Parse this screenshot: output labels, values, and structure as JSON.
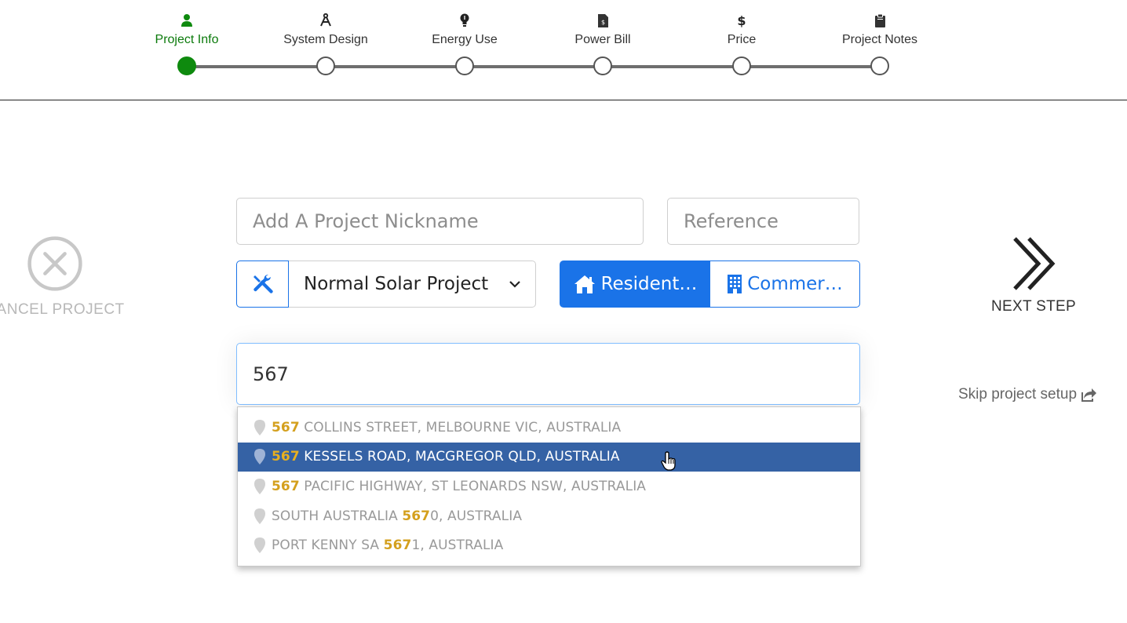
{
  "stepper": {
    "steps": [
      {
        "label": "Project Info",
        "icon": "person-icon",
        "active": true
      },
      {
        "label": "System Design",
        "icon": "compass-icon",
        "active": false
      },
      {
        "label": "Energy Use",
        "icon": "lightbulb-icon",
        "active": false
      },
      {
        "label": "Power Bill",
        "icon": "document-dollar-icon",
        "active": false
      },
      {
        "label": "Price",
        "icon": "dollar-icon",
        "active": false
      },
      {
        "label": "Project Notes",
        "icon": "clipboard-icon",
        "active": false
      }
    ],
    "active_color": "#0e8a0e"
  },
  "cancel": {
    "label": "CANCEL PROJECT",
    "icon": "close-circle-icon"
  },
  "next": {
    "label": "NEXT STEP",
    "icon": "double-chevron-right-icon"
  },
  "skip": {
    "label": "Skip project setup",
    "icon": "share-icon"
  },
  "form": {
    "nickname_placeholder": "Add A Project Nickname",
    "reference_placeholder": "Reference",
    "project_type": {
      "value": "Normal Solar Project",
      "icon": "wrench-screwdriver-icon"
    },
    "segment": {
      "residential": {
        "label": "Resident…",
        "icon": "house-icon",
        "selected": true
      },
      "commercial": {
        "label": "Commer…",
        "icon": "building-icon",
        "selected": false
      }
    },
    "address_value": "567"
  },
  "autocomplete": {
    "items": [
      {
        "match": "567",
        "rest": " COLLINS STREET, MELBOURNE VIC, AUSTRALIA",
        "pre": "",
        "selected": false
      },
      {
        "match": "567",
        "rest": " KESSELS ROAD, MACGREGOR QLD, AUSTRALIA",
        "pre": "",
        "selected": true
      },
      {
        "match": "567",
        "rest": " PACIFIC HIGHWAY, ST LEONARDS NSW, AUSTRALIA",
        "pre": "",
        "selected": false
      },
      {
        "pre": "SOUTH AUSTRALIA ",
        "match": "567",
        "rest": "0, AUSTRALIA",
        "selected": false
      },
      {
        "pre": "PORT KENNY SA ",
        "match": "567",
        "rest": "1, AUSTRALIA",
        "selected": false
      }
    ],
    "match_color": "#d4a01e",
    "selected_bg": "#3562a5"
  },
  "colors": {
    "primary": "#1a73e8"
  }
}
